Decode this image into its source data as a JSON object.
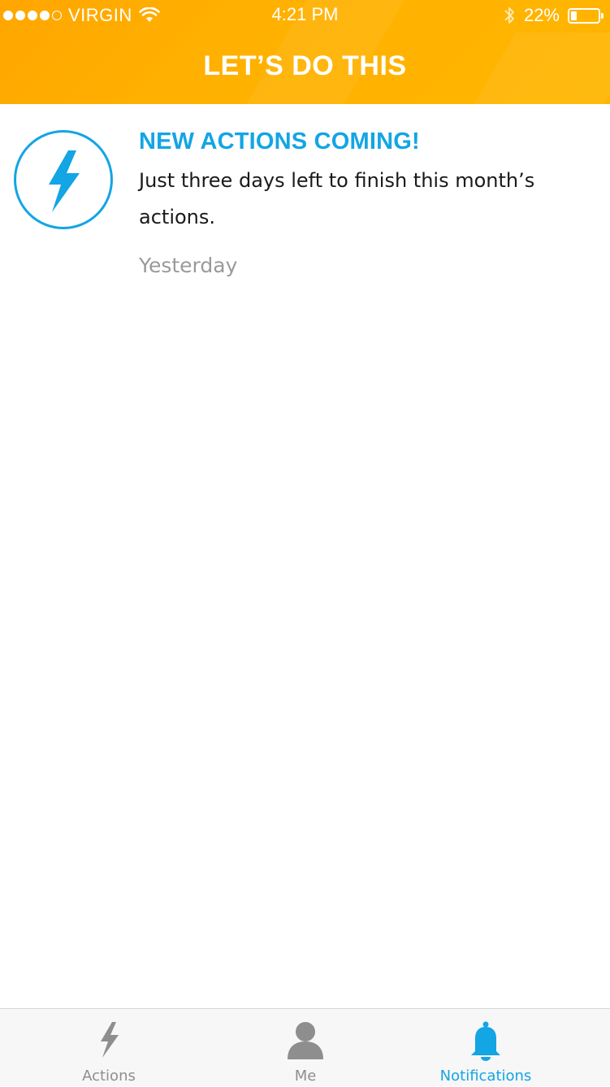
{
  "status_bar": {
    "carrier": "VIRGIN",
    "signal_bars_filled": 4,
    "signal_bars_total": 5,
    "time": "4:21 PM",
    "battery_percent": "22%",
    "battery_level": 0.22,
    "icons": [
      "wifi-icon",
      "bluetooth-icon",
      "battery-icon"
    ]
  },
  "header": {
    "title": "LET’S DO THIS",
    "background_color": "#FFB000"
  },
  "notifications": [
    {
      "icon": "lightning-bolt-icon",
      "title": "NEW ACTIONS COMING!",
      "body": "Just three days left to finish this month’s actions.",
      "time": "Yesterday"
    }
  ],
  "tabbar": {
    "tabs": [
      {
        "label": "Actions",
        "icon": "lightning-bolt-icon",
        "active": false
      },
      {
        "label": "Me",
        "icon": "person-icon",
        "active": false
      },
      {
        "label": "Notifications",
        "icon": "bell-icon",
        "active": true
      }
    ]
  },
  "colors": {
    "accent": "#13A5E4",
    "inactive": "#8E8E8E",
    "header": "#FFB000"
  }
}
